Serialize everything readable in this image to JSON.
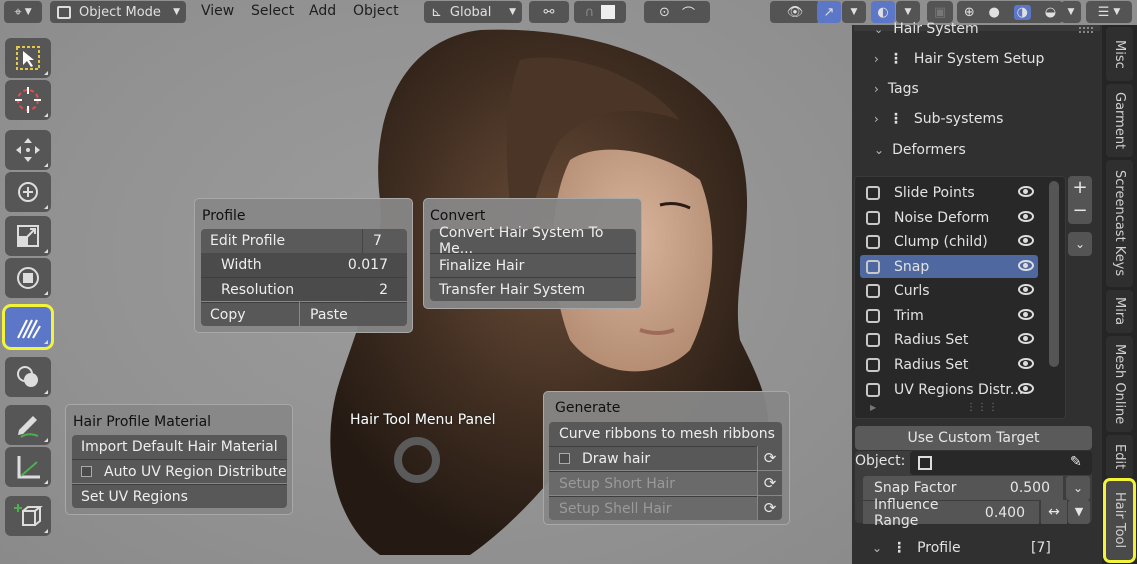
{
  "header": {
    "mode_label": "Object Mode",
    "menus": [
      "View",
      "Select",
      "Add",
      "Object"
    ],
    "transform_orientation": "Global"
  },
  "sidebar": {
    "section_title": "Hair System",
    "items": [
      "Hair System Setup",
      "Tags",
      "Sub-systems",
      "Deformers"
    ],
    "deformers": [
      "Slide Points",
      "Noise Deform",
      "Clump (child)",
      "Snap",
      "Curls",
      "Trim",
      "Radius Set",
      "Radius Set",
      "UV Regions Distr..."
    ],
    "selected_deformer": "Snap",
    "use_custom_target_label": "Use Custom Target",
    "object_label": "Object:",
    "snap_factor_label": "Snap Factor",
    "snap_factor_value": "0.500",
    "influence_range_label": "Influence Range",
    "influence_range_value": "0.400",
    "profile_label": "Profile",
    "profile_count": "[7]"
  },
  "tabs": [
    "Misc",
    "Garment",
    "Screencast Keys",
    "Mira",
    "Mesh Online",
    "Edit",
    "Hair Tool"
  ],
  "active_tab": "Hair Tool",
  "pie_center_label": "Hair Tool Menu Panel",
  "profile_panel": {
    "title": "Profile",
    "edit_profile_label": "Edit Profile",
    "edit_profile_value": "7",
    "width_label": "Width",
    "width_value": "0.017",
    "resolution_label": "Resolution",
    "resolution_value": "2",
    "copy_label": "Copy",
    "paste_label": "Paste"
  },
  "convert_panel": {
    "title": "Convert",
    "items": [
      "Convert Hair System To Me...",
      "Finalize Hair",
      "Transfer Hair System"
    ]
  },
  "material_panel": {
    "title": "Hair Profile Material",
    "import_label": "Import Default Hair Material",
    "auto_uv_label": "Auto UV Region Distribute",
    "set_uv_label": "Set UV Regions"
  },
  "generate_panel": {
    "title": "Generate",
    "curve_ribbons_label": "Curve ribbons to mesh ribbons",
    "draw_hair_label": "Draw hair",
    "setup_short_label": "Setup Short Hair",
    "setup_shell_label": "Setup Shell Hair"
  },
  "colors": {
    "accent": "#5c77c7",
    "highlight": "#f3f33a",
    "panel_row": "#585858"
  }
}
